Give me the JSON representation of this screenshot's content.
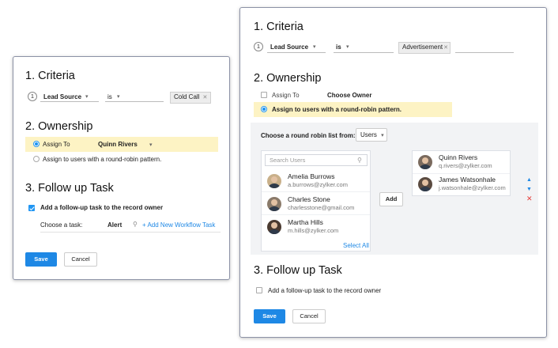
{
  "left_panel": {
    "criteria_heading": "1. Criteria",
    "criteria_num": "1",
    "criteria_field": "Lead Source",
    "criteria_operator": "is",
    "criteria_value": "Cold Call",
    "ownership_heading": "2. Ownership",
    "assign_to_label": "Assign To",
    "assign_to_value": "Quinn Rivers",
    "round_robin_label": "Assign to users with a round-robin pattern.",
    "followup_heading": "3. Follow up Task",
    "followup_checkbox_label": "Add a follow-up task to the record owner",
    "choose_task_label": "Choose a task:",
    "task_value": "Alert",
    "add_workflow_link": "+ Add New Workflow Task",
    "save_label": "Save",
    "cancel_label": "Cancel"
  },
  "right_panel": {
    "criteria_heading": "1. Criteria",
    "criteria_num": "1",
    "criteria_field": "Lead Source",
    "criteria_operator": "is",
    "criteria_value": "Advertisement",
    "ownership_heading": "2. Ownership",
    "assign_to_label": "Assign To",
    "assign_to_value": "Choose Owner",
    "round_robin_label": "Assign to users with a round-robin pattern.",
    "rr_list_label": "Choose a round robin list from:",
    "rr_list_value": "Users",
    "search_placeholder": "Search Users",
    "available_users": [
      {
        "name": "Amelia Burrows",
        "email": "a.burrows@zylker.com"
      },
      {
        "name": "Charles Stone",
        "email": "charlesstone@gmail.com"
      },
      {
        "name": "Martha Hills",
        "email": "m.hills@zylker.com"
      }
    ],
    "select_all_label": "Select All",
    "add_button_label": "Add",
    "selected_users": [
      {
        "name": "Quinn Rivers",
        "email": "q.rivers@zylker.com"
      },
      {
        "name": "James Watsonhale",
        "email": "j.watsonhale@zylker.com"
      }
    ],
    "followup_heading": "3. Follow up Task",
    "followup_checkbox_label": "Add a follow-up task to the record owner",
    "save_label": "Save",
    "cancel_label": "Cancel"
  },
  "colors": {
    "accent": "#1e88e5",
    "highlight": "#fdf3c4",
    "remove": "#e53935"
  },
  "icons": [
    "search-icon",
    "move-up-icon",
    "move-down-icon",
    "remove-icon",
    "chevron-down-icon",
    "clear-icon"
  ]
}
